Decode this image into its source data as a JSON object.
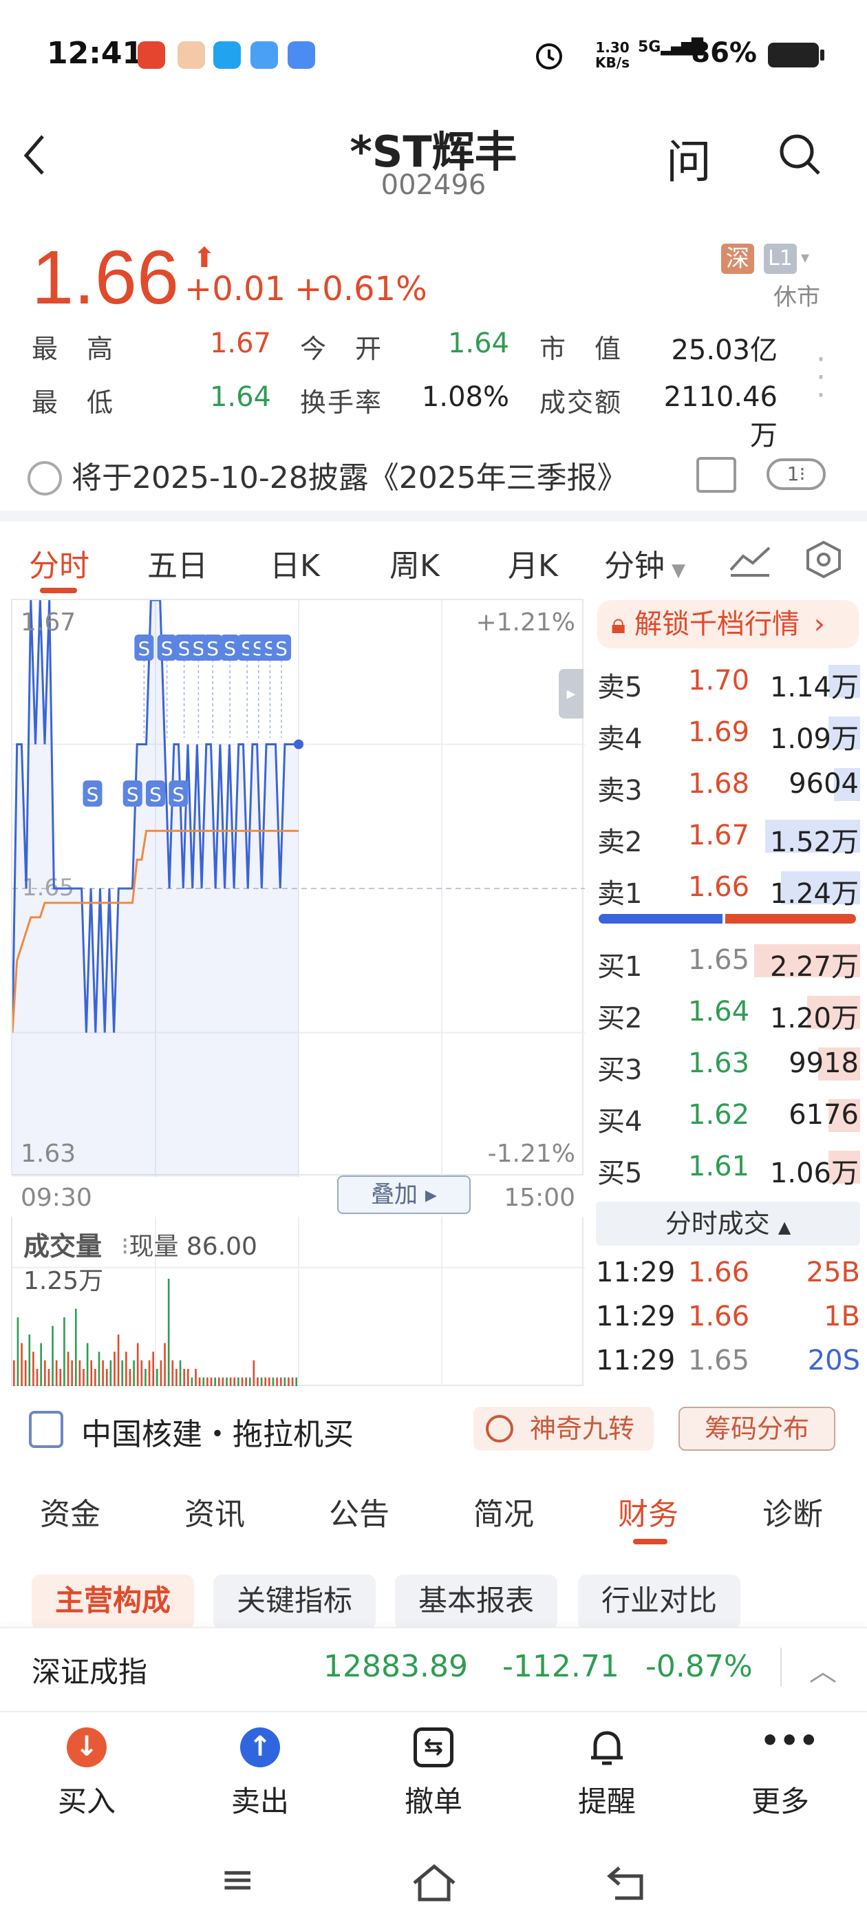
{
  "status_bar": {
    "time": "12:41",
    "net_speed_value": "1.30",
    "net_speed_unit": "KB/s",
    "signal": "5G",
    "battery": "86%"
  },
  "header": {
    "stock_name": "*ST辉丰",
    "stock_code": "002496",
    "ask_label": "问"
  },
  "quote": {
    "price": "1.66",
    "change": "+0.01",
    "change_pct": "+0.61%",
    "exchange_badge": "深",
    "level_badge": "L1",
    "market_status": "休市",
    "stats": [
      {
        "label": "最　高",
        "value": "1.67",
        "color": "red"
      },
      {
        "label": "今　开",
        "value": "1.64",
        "color": "green"
      },
      {
        "label": "市　值",
        "value": "25.03亿",
        "color": "black"
      },
      {
        "label": "最　低",
        "value": "1.64",
        "color": "green"
      },
      {
        "label": "换手率",
        "value": "1.08%",
        "color": "black"
      },
      {
        "label": "成交额",
        "value": "2110.46万",
        "color": "black"
      }
    ]
  },
  "notice": {
    "text": "将于2025-10-28披露《2025年三季报》",
    "page": "1"
  },
  "chart_tabs": [
    "分时",
    "五日",
    "日K",
    "周K",
    "月K",
    "分钟"
  ],
  "chart": {
    "y_max": "1.67",
    "y_mid": "1.65",
    "y_min": "1.63",
    "pct_max": "+1.21%",
    "pct_min": "-1.21%",
    "time_start": "09:30",
    "time_end": "15:00",
    "overlay_label": "叠加",
    "marker": "S"
  },
  "volume": {
    "label": "成交量",
    "current": "现量 86.00",
    "max": "1.25万"
  },
  "chart_data": {
    "type": "line",
    "title": "",
    "ylim": [
      1.63,
      1.67
    ],
    "price_series": [
      1.64,
      1.66,
      1.66,
      1.65,
      1.67,
      1.66,
      1.67,
      1.66,
      1.67,
      1.65,
      1.65,
      1.65,
      1.65,
      1.65,
      1.65,
      1.65,
      1.64,
      1.65,
      1.64,
      1.65,
      1.64,
      1.65,
      1.64,
      1.65,
      1.65,
      1.65,
      1.65,
      1.66,
      1.66,
      1.66,
      1.67,
      1.67,
      1.67,
      1.66,
      1.65,
      1.66,
      1.66,
      1.65,
      1.66,
      1.65,
      1.66,
      1.65,
      1.66,
      1.66,
      1.65,
      1.66,
      1.65,
      1.66,
      1.65,
      1.66,
      1.66,
      1.65,
      1.66,
      1.66,
      1.65,
      1.66,
      1.66,
      1.66,
      1.65,
      1.66,
      1.66,
      1.66,
      1.66
    ],
    "avg_series": [
      1.64,
      1.645,
      1.646,
      1.647,
      1.648,
      1.648,
      1.648,
      1.649,
      1.649,
      1.649,
      1.649,
      1.649,
      1.649,
      1.649,
      1.649,
      1.649,
      1.649,
      1.649,
      1.649,
      1.649,
      1.649,
      1.649,
      1.649,
      1.649,
      1.649,
      1.649,
      1.649,
      1.652,
      1.652,
      1.654,
      1.654,
      1.654,
      1.654,
      1.654,
      1.654,
      1.654,
      1.654,
      1.654,
      1.654,
      1.654,
      1.654,
      1.654,
      1.654,
      1.654,
      1.654,
      1.654,
      1.654,
      1.654,
      1.654,
      1.654,
      1.654,
      1.654,
      1.654,
      1.654,
      1.654,
      1.654,
      1.654,
      1.654,
      1.654,
      1.654,
      1.654,
      1.654,
      1.654
    ],
    "volume_series": [
      0.3,
      0.8,
      0.5,
      0.3,
      0.6,
      0.4,
      0.2,
      0.5,
      0.3,
      0.2,
      0.7,
      0.3,
      0.2,
      0.8,
      0.4,
      0.3,
      0.9,
      0.3,
      0.2,
      0.5,
      0.3,
      0.2,
      0.4,
      0.3,
      0.2,
      0.3,
      0.4,
      0.6,
      0.3,
      0.4,
      0.2,
      0.3,
      0.5,
      0.3,
      0.2,
      0.3,
      0.4,
      0.2,
      0.3,
      0.5,
      1.25,
      0.3,
      0.2,
      0.3,
      0.2,
      0.2,
      0.1,
      0.2,
      0.1,
      0.1,
      0.1,
      0.1,
      0.1,
      0.1,
      0.1,
      0.1,
      0.1,
      0.1,
      0.1,
      0.1,
      0.1,
      0.1,
      0.3,
      0.1,
      0.1,
      0.1,
      0.1,
      0.1,
      0.1,
      0.1,
      0.1,
      0.1,
      0.1,
      0.1
    ]
  },
  "order_book": {
    "unlock_label": "解锁千档行情",
    "asks": [
      {
        "label": "卖5",
        "price": "1.70",
        "volume": "1.14万",
        "depth": 0.12
      },
      {
        "label": "卖4",
        "price": "1.69",
        "volume": "1.09万",
        "depth": 0.12
      },
      {
        "label": "卖3",
        "price": "1.68",
        "volume": "9604",
        "depth": 0.1
      },
      {
        "label": "卖2",
        "price": "1.67",
        "volume": "1.52万",
        "depth": 0.36
      },
      {
        "label": "卖1",
        "price": "1.66",
        "volume": "1.24万",
        "depth": 0.3
      }
    ],
    "bids": [
      {
        "label": "买1",
        "price": "1.65",
        "volume": "2.27万",
        "depth": 0.4
      },
      {
        "label": "买2",
        "price": "1.64",
        "volume": "1.20万",
        "depth": 0.2
      },
      {
        "label": "买3",
        "price": "1.63",
        "volume": "9918",
        "depth": 0.16
      },
      {
        "label": "买4",
        "price": "1.62",
        "volume": "6176",
        "depth": 0.12
      },
      {
        "label": "买5",
        "price": "1.61",
        "volume": "1.06万",
        "depth": 0.12
      }
    ],
    "buy_ratio": 0.48
  },
  "trades": {
    "header": "分时成交",
    "rows": [
      {
        "time": "11:29",
        "price": "1.66",
        "vol": "25B",
        "color": "red"
      },
      {
        "time": "11:29",
        "price": "1.66",
        "vol": "1B",
        "color": "red"
      },
      {
        "time": "11:29",
        "price": "1.65",
        "vol": "20S",
        "color": "blue"
      }
    ]
  },
  "hot": {
    "text": "中国核建・拖拉机买",
    "btn_nine": "神奇九转",
    "btn_chips": "筹码分布"
  },
  "section_tabs": [
    "资金",
    "资讯",
    "公告",
    "简况",
    "财务",
    "诊断"
  ],
  "sub_tabs": [
    "主营构成",
    "关键指标",
    "基本报表",
    "行业对比"
  ],
  "index": {
    "name": "深证成指",
    "value": "12883.89",
    "change": "-112.71",
    "pct": "-0.87%"
  },
  "actions": [
    {
      "label": "买入",
      "icon": "arrow-down-icon"
    },
    {
      "label": "卖出",
      "icon": "arrow-up-icon"
    },
    {
      "label": "撤单",
      "icon": "undo-order-icon"
    },
    {
      "label": "提醒",
      "icon": "bell-icon"
    },
    {
      "label": "更多",
      "icon": "more-dots-icon"
    }
  ],
  "colors": {
    "red": "#e04b2b",
    "green": "#2e9d52",
    "blue": "#3a64d8",
    "avg_line": "#f08a3c"
  }
}
